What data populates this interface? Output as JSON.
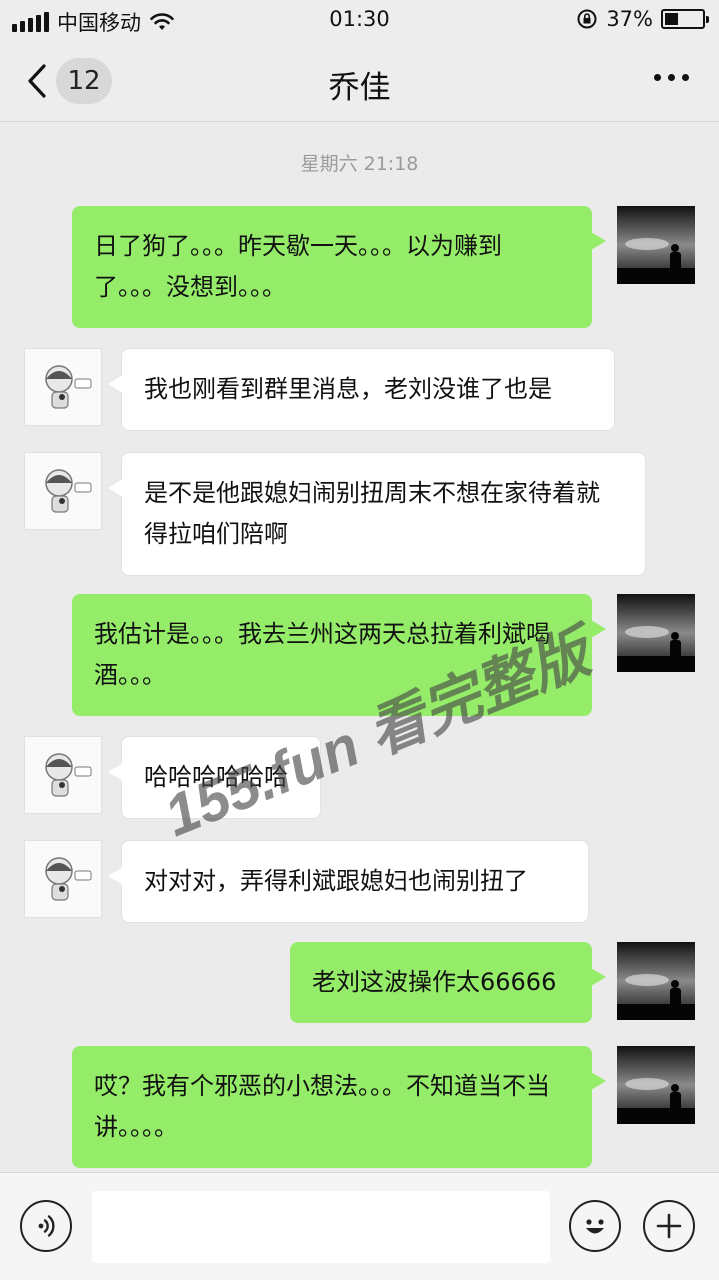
{
  "status_bar": {
    "carrier": "中国移动",
    "time": "01:30",
    "battery_percent": "37%",
    "battery_level": 0.37,
    "icons": [
      "signal-icon",
      "wifi-icon",
      "rotation-lock-icon",
      "battery-icon"
    ]
  },
  "header": {
    "unread_count": "12",
    "title": "乔佳",
    "back_icon": "chevron-left-icon",
    "more_icon": "more-dots-icon"
  },
  "chat": {
    "timestamp": "星期六 21:18",
    "messages": [
      {
        "side": "self",
        "text": "日了狗了。。。昨天歇一天。。。以为赚到了。。。没想到。。。"
      },
      {
        "side": "other",
        "text": "我也刚看到群里消息，老刘没谁了也是"
      },
      {
        "side": "other",
        "text": "是不是他跟媳妇闹别扭周末不想在家待着就得拉咱们陪啊"
      },
      {
        "side": "self",
        "text": "我估计是。。。我去兰州这两天总拉着利斌喝酒。。。"
      },
      {
        "side": "other",
        "text": "哈哈哈哈哈哈"
      },
      {
        "side": "other",
        "text": "对对对，弄得利斌跟媳妇也闹别扭了"
      },
      {
        "side": "self",
        "text": "老刘这波操作太66666"
      },
      {
        "side": "self",
        "text": "哎？我有个邪恶的小想法。。。不知道当不当讲。。。。"
      }
    ]
  },
  "watermark": "155.fun 看完整版",
  "input_bar": {
    "placeholder": "",
    "voice_icon": "voice-icon",
    "emoji_icon": "emoji-icon",
    "plus_icon": "plus-icon"
  },
  "colors": {
    "self_bubble": "#95ec69",
    "other_bubble": "#ffffff",
    "background": "#ebebeb"
  }
}
